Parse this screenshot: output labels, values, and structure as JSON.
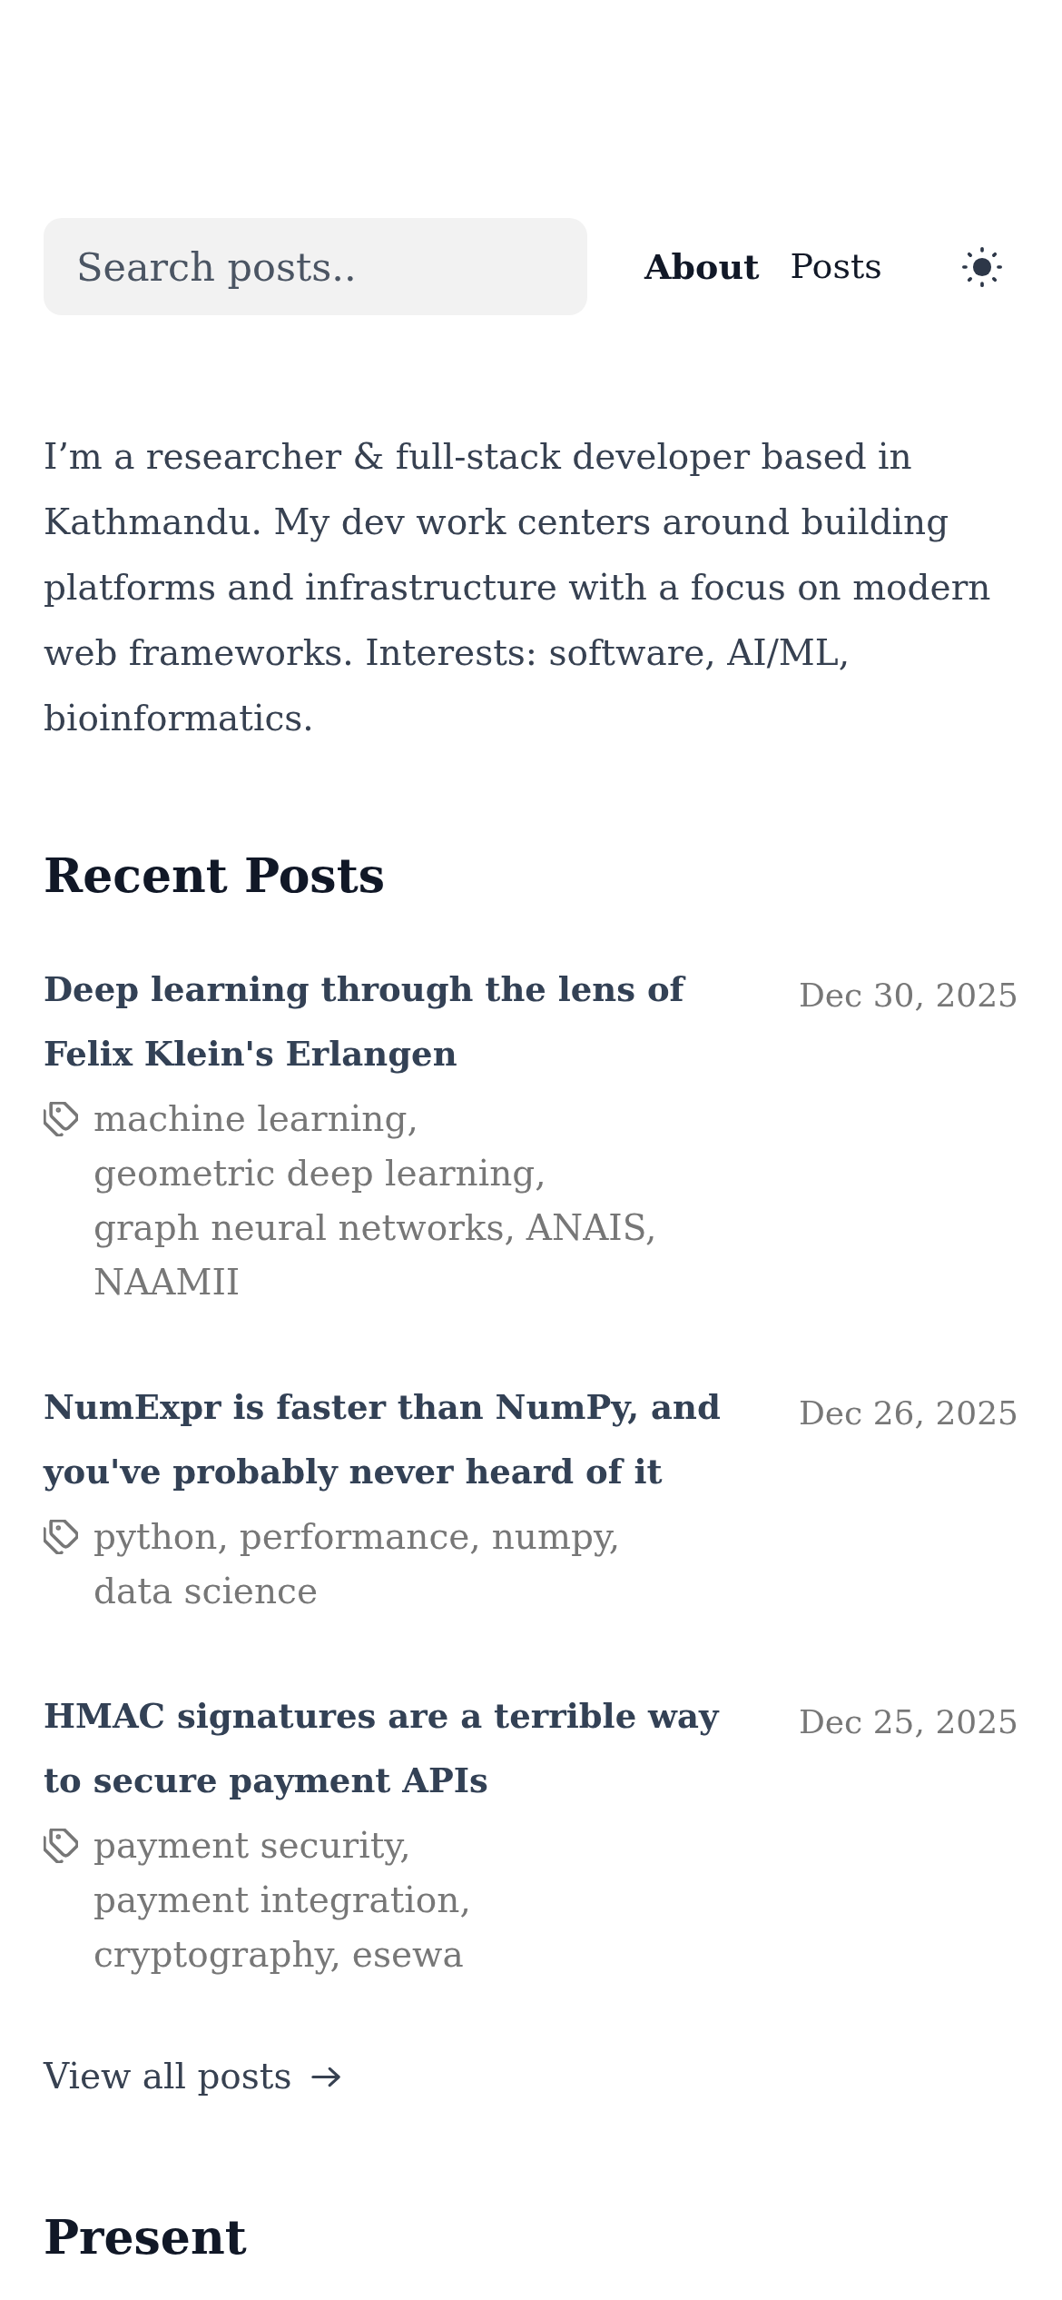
{
  "search": {
    "placeholder": "Search posts.."
  },
  "nav": [
    {
      "label": "About",
      "selected": true
    },
    {
      "label": "Posts",
      "selected": false
    }
  ],
  "intro": "I’m a researcher & full-stack developer based in Kathmandu. My dev work centers around building platforms and infrastructure with a focus on modern web frameworks. Interests: software, AI/ML, bioinformatics.",
  "recent_posts": {
    "heading": "Recent Posts",
    "posts": [
      {
        "title": "Deep learning through the lens of Felix Klein's Erlangen",
        "date": "Dec 30, 2025",
        "tags": [
          "machine learning,",
          "geometric deep learning,",
          "graph neural networks,",
          "ANAIS,",
          "NAAMII"
        ]
      },
      {
        "title": "NumExpr is faster than NumPy, and you've probably never heard of it",
        "date": "Dec 26, 2025",
        "tags": [
          "python,",
          "performance,",
          "numpy,",
          "data science"
        ]
      },
      {
        "title": "HMAC signatures are a terrible way to secure payment APIs",
        "date": "Dec 25, 2025",
        "tags": [
          "payment security,",
          "payment integration,",
          "cryptography,",
          "esewa"
        ]
      }
    ],
    "view_all": "View all posts"
  },
  "present": {
    "heading": "Present"
  }
}
